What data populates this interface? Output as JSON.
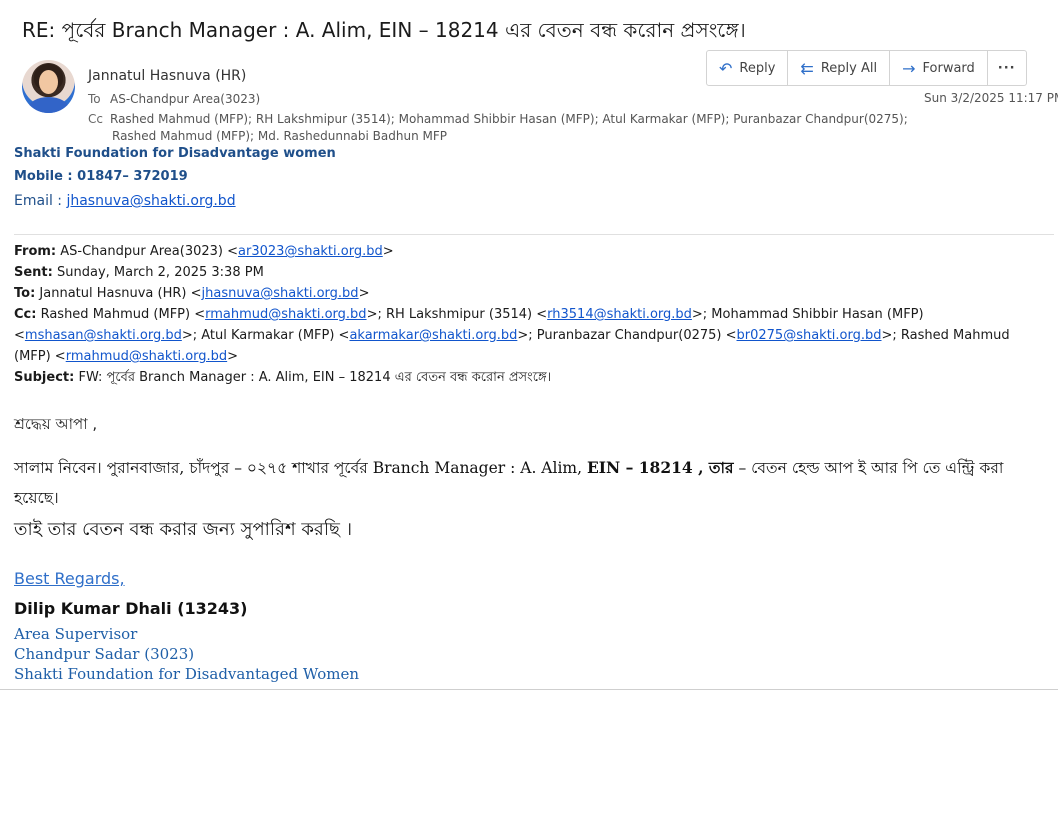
{
  "email": {
    "subject": "RE: পূর্বের Branch Manager : A. Alim, EIN – 18214 এর বেতন বন্ধ করোন প্রসংঙ্গে।",
    "sender": "Jannatul Hasnuva (HR)",
    "to_label": "To",
    "to_value": "AS-Chandpur Area(3023)",
    "cc_label": "Cc",
    "cc_line1": "Rashed Mahmud (MFP); RH Lakshmipur (3514); Mohammad Shibbir Hasan (MFP); Atul  Karmakar (MFP); Puranbazar Chandpur(0275);",
    "cc_line2": "Rashed Mahmud (MFP); Md. Rashedunnabi Badhun MFP",
    "date": "Sun 3/2/2025 11:17 PM"
  },
  "actions": {
    "reply": "Reply",
    "reply_all": "Reply All",
    "forward": "Forward",
    "more": "···",
    "reply_icon": "reply-arrow-icon",
    "reply_all_icon": "reply-all-arrow-icon",
    "forward_icon": "forward-arrow-icon"
  },
  "hr_signature": {
    "org": "Shakti Foundation for Disadvantage women",
    "mobile": "Mobile : 01847– 372019",
    "email_label": "Email  :  ",
    "email": "jhasnuva@shakti.org.bd"
  },
  "forwarded": {
    "from_label": "From:",
    "from_text": " AS-Chandpur Area(3023) <",
    "from_email": "ar3023@shakti.org.bd",
    "sent_label": "Sent:",
    "sent_text": " Sunday, March 2, 2025 3:38 PM",
    "to_label": "To:",
    "to_text": " Jannatul Hasnuva (HR) <",
    "to_email": "jhasnuva@shakti.org.bd",
    "cc_label": "Cc:",
    "cc_1": " Rashed Mahmud (MFP) <",
    "cc_1_email": "rmahmud@shakti.org.bd",
    "cc_2": ">; RH Lakshmipur (3514) <",
    "cc_2_email": "rh3514@shakti.org.bd",
    "cc_3": ">; Mohammad Shibbir Hasan (MFP) <",
    "cc_3_email": "mshasan@shakti.org.bd",
    "cc_4": ">; Atul Karmakar (MFP) <",
    "cc_4_email": "akarmakar@shakti.org.bd",
    "cc_5": ">; Puranbazar Chandpur(0275) <",
    "cc_5_email": "br0275@shakti.org.bd",
    "cc_6": ">; Rashed Mahmud (MFP) <",
    "cc_6_email": "rmahmud@shakti.org.bd",
    "subject_label": "Subject:",
    "subject_text": " FW: পূর্বের  Branch Manager : A. Alim, EIN – 18214 এর বেতন বন্ধ করোন প্রসংঙ্গে।"
  },
  "body": {
    "greeting": "শ্রদ্ধেয় আপা ,",
    "para1_a": "সালাম নিবেন। পুরানবাজার, চাঁদপুর – ০২৭৫ শাখার পূর্বের Branch Manager : A. Alim, ",
    "para1_b": "EIN – 18214 , তার",
    "para1_c": " – বেতন হেল্ড আপ ই আর পি তে এন্ট্রি করা হয়েছে।",
    "para2": "তাই তার বেতন বন্ধ করার জন্য সুপারিশ করছি ।"
  },
  "signature": {
    "regards": "Best  Regards,",
    "name": "Dilip Kumar Dhali (13243)",
    "title": "Area Supervisor",
    "office": "Chandpur Sadar (3023)",
    "org": "Shakti Foundation for Disadvantaged Women"
  }
}
